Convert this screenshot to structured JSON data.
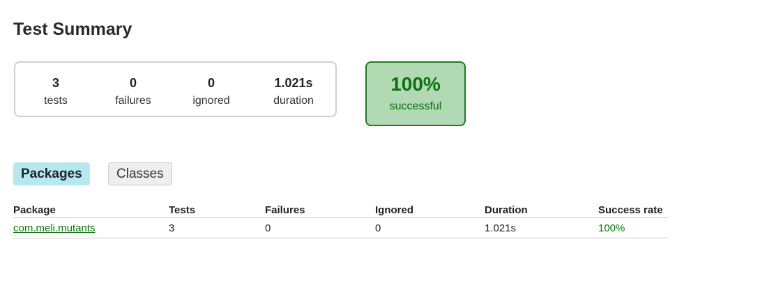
{
  "page": {
    "title": "Test Summary"
  },
  "summary": {
    "tests": {
      "value": "3",
      "label": "tests"
    },
    "failures": {
      "value": "0",
      "label": "failures"
    },
    "ignored": {
      "value": "0",
      "label": "ignored"
    },
    "duration": {
      "value": "1.021s",
      "label": "duration"
    }
  },
  "success": {
    "rate": "100%",
    "label": "successful"
  },
  "tabs": [
    {
      "label": "Packages",
      "selected": true
    },
    {
      "label": "Classes",
      "selected": false
    }
  ],
  "table": {
    "headers": [
      "Package",
      "Tests",
      "Failures",
      "Ignored",
      "Duration",
      "Success rate"
    ],
    "rows": [
      {
        "package": "com.meli.mutants",
        "tests": "3",
        "failures": "0",
        "ignored": "0",
        "duration": "1.021s",
        "success_rate": "100%"
      }
    ]
  },
  "colors": {
    "success_text": "#0c720c",
    "success_bg": "#b0d9b4",
    "success_border": "#1e7b1e",
    "tab_selected_bg": "#b5e8f0",
    "tab_bg": "#eeeeee"
  }
}
